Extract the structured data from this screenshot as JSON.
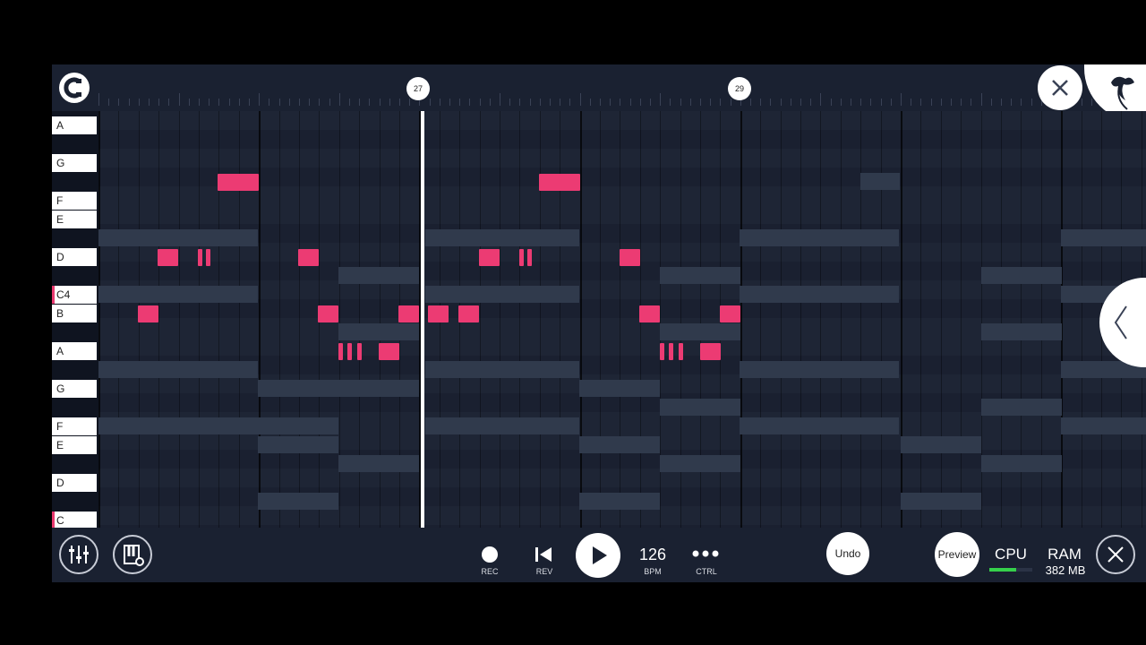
{
  "timeline": {
    "markers": [
      "27",
      "29"
    ]
  },
  "keys": [
    "A",
    "G",
    "F",
    "E",
    "D",
    "C4",
    "B",
    "A",
    "G",
    "F",
    "E",
    "D",
    "C"
  ],
  "transport": {
    "rec_label": "REC",
    "rev_label": "REV",
    "bpm_value": "126",
    "bpm_label": "BPM",
    "ctrl_label": "CTRL",
    "undo_label": "Undo",
    "preview_label": "Preview",
    "cpu_label": "CPU",
    "ram_label": "RAM",
    "ram_value": "382 MB"
  },
  "colors": {
    "note": "#ec3b73",
    "background": "#151b28",
    "accent": "#ffffff",
    "cpu_meter": "#35d04b"
  },
  "icons": [
    "magnet-icon",
    "close-icon",
    "fl-fruit-logo",
    "mixer-icon",
    "piano-settings-icon",
    "record-icon",
    "rewind-icon",
    "play-icon",
    "more-icon",
    "chevron-left-icon"
  ]
}
